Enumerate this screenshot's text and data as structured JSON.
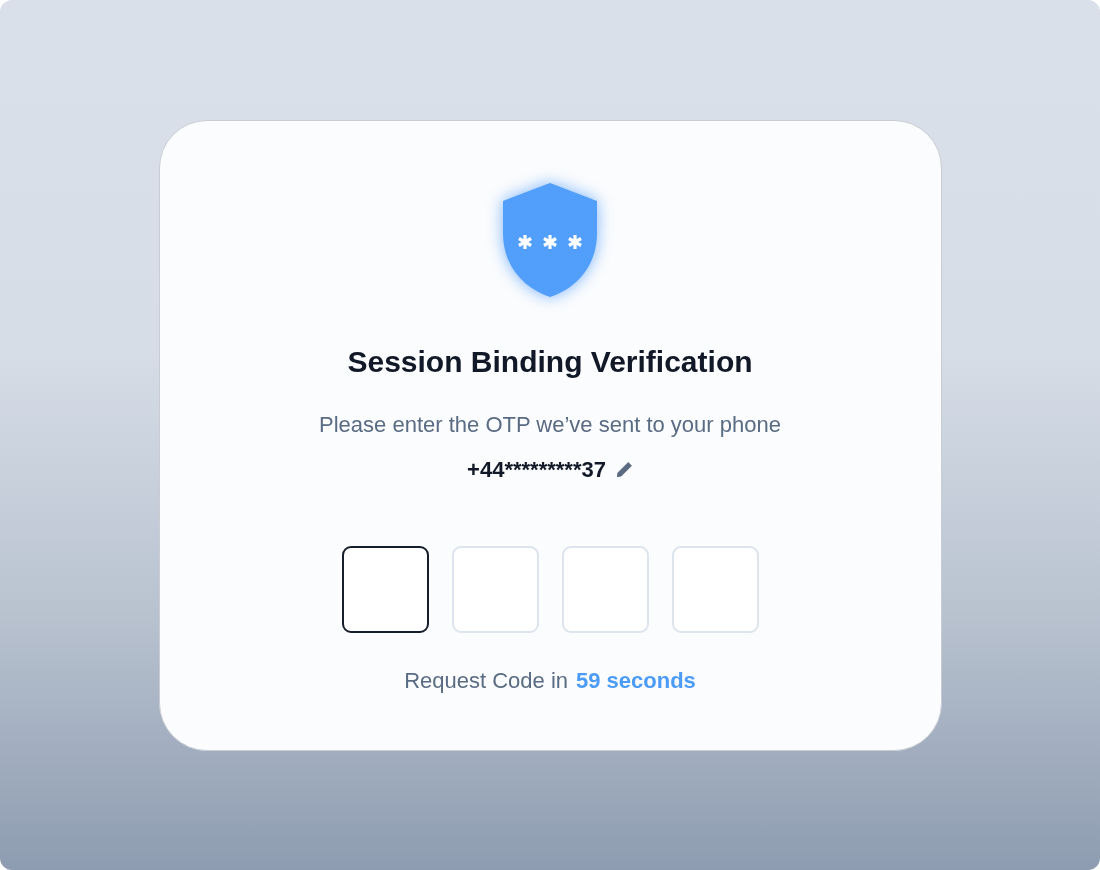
{
  "dialog": {
    "title": "Session Binding Verification",
    "subtitle": "Please enter the OTP we’ve sent to your phone",
    "phone": "+44*********37",
    "otp_fields": [
      {
        "selected": true
      },
      {
        "selected": false
      },
      {
        "selected": false
      },
      {
        "selected": false
      }
    ],
    "resend": {
      "label": "Request Code in",
      "countdown": "59 seconds"
    }
  }
}
